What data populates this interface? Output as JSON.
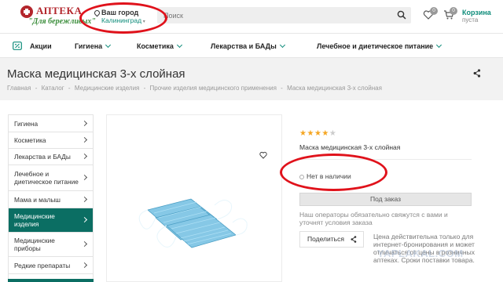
{
  "header": {
    "logo": {
      "title": "АПТЕКА",
      "subtitle": "\"Для бережливых\""
    },
    "city": {
      "label": "Ваш город",
      "value": "Калининград"
    },
    "search": {
      "placeholder": "Поиск"
    },
    "favorites": {
      "icon": "heart-icon",
      "count": "0"
    },
    "cart": {
      "icon": "cart-icon",
      "count": "0",
      "title": "Корзина",
      "status": "пуста"
    }
  },
  "nav": {
    "items": [
      {
        "label": "Акции",
        "icon": "percent-tag-icon"
      },
      {
        "label": "Гигиена"
      },
      {
        "label": "Косметика"
      },
      {
        "label": "Лекарства и БАДы"
      },
      {
        "label": "Лечебное и диетическое питание"
      }
    ]
  },
  "page": {
    "title": "Маска медицинская 3-х слойная",
    "breadcrumb": [
      "Главная",
      "-",
      "Каталог",
      "-",
      "Медицинские изделия",
      "-",
      "Прочие изделия медицинского применения",
      "-",
      "Маска медицинская 3-х слойная"
    ]
  },
  "sidebar": {
    "items": [
      {
        "label": "Гигиена"
      },
      {
        "label": "Косметика"
      },
      {
        "label": "Лекарства и БАДы"
      },
      {
        "label": "Лечебное и диетическое питание"
      },
      {
        "label": "Мама и малыш"
      },
      {
        "label": "Медицинские изделия"
      },
      {
        "label": "Медицинские приборы"
      },
      {
        "label": "Редкие препараты"
      }
    ],
    "active_index": 5
  },
  "product": {
    "name": "Маска медицинская 3-х слойная",
    "rating": 4,
    "rating_max": 5,
    "stock": "Нет в наличии",
    "order_button": "Под заказ",
    "order_note": "Наш операторы обязательно свяжутся с вами и уточнят условия заказа",
    "share_button": "Поделиться",
    "price_note": "Цена действительна только для интернет-бронирования и может отличаться от цены в розничных аптеках. Сроки поставки товара."
  },
  "colors": {
    "accent": "#0e8c7a",
    "active_bg": "#0b6e63",
    "brand_red": "#b3262c",
    "annotation": "#e0121b",
    "star_on": "#f5a623",
    "star_off": "#cccccc"
  },
  "watermark": "YAPLAKAL.COM"
}
